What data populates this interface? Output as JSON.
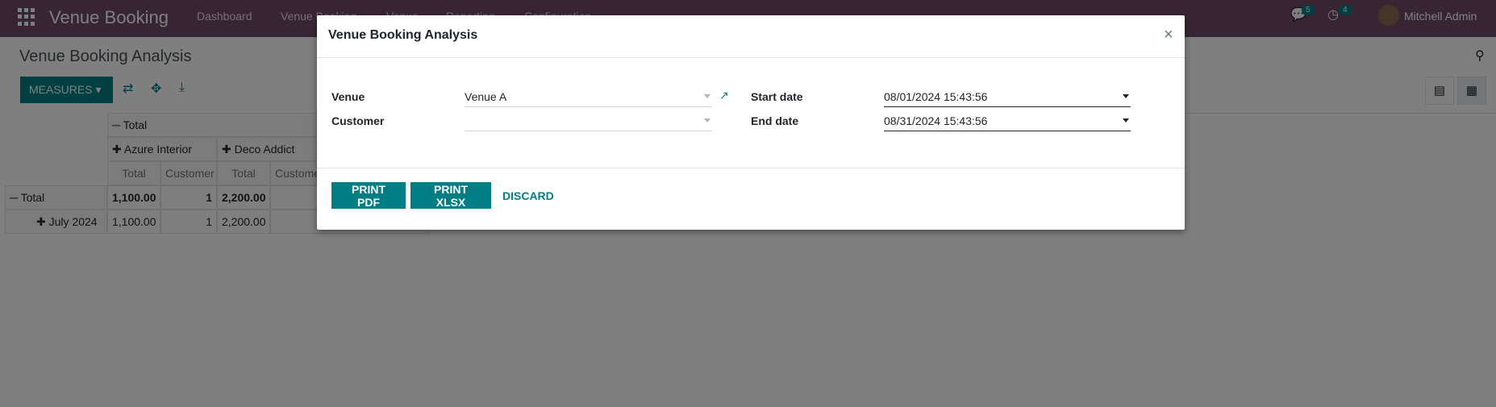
{
  "navbar": {
    "brand": "Venue Booking",
    "menu": [
      "Dashboard",
      "Venue Booking",
      "Venue",
      "Reporting",
      "Configuration"
    ],
    "messages_badge": "5",
    "activities_badge": "4",
    "user_name": "Mitchell Admin"
  },
  "control_panel": {
    "title": "Venue Booking Analysis",
    "measures_label": "MEASURES"
  },
  "pivot": {
    "header_total": "Total",
    "col_groups": [
      "Azure Interior",
      "Deco Addict"
    ],
    "measure_headers": [
      "Total",
      "Customer",
      "Total",
      "Custome"
    ],
    "rows": [
      {
        "label": "Total",
        "values": [
          "1,100.00",
          "1",
          "2,200.00",
          ""
        ]
      },
      {
        "label": "July 2024",
        "values": [
          "1,100.00",
          "1",
          "2,200.00",
          ""
        ]
      }
    ]
  },
  "modal": {
    "title": "Venue Booking Analysis",
    "close_symbol": "×",
    "venue_label": "Venue",
    "venue_value": "Venue A",
    "customer_label": "Customer",
    "customer_value": "",
    "start_date_label": "Start date",
    "start_date_value": "08/01/2024 15:43:56",
    "end_date_label": "End date",
    "end_date_value": "08/31/2024 15:43:56",
    "print_pdf_label": "PRINT PDF",
    "print_xlsx_label": "PRINT XLSX",
    "discard_label": "DISCARD"
  },
  "colors": {
    "navbar": "#714B67",
    "primary": "#017e84"
  }
}
